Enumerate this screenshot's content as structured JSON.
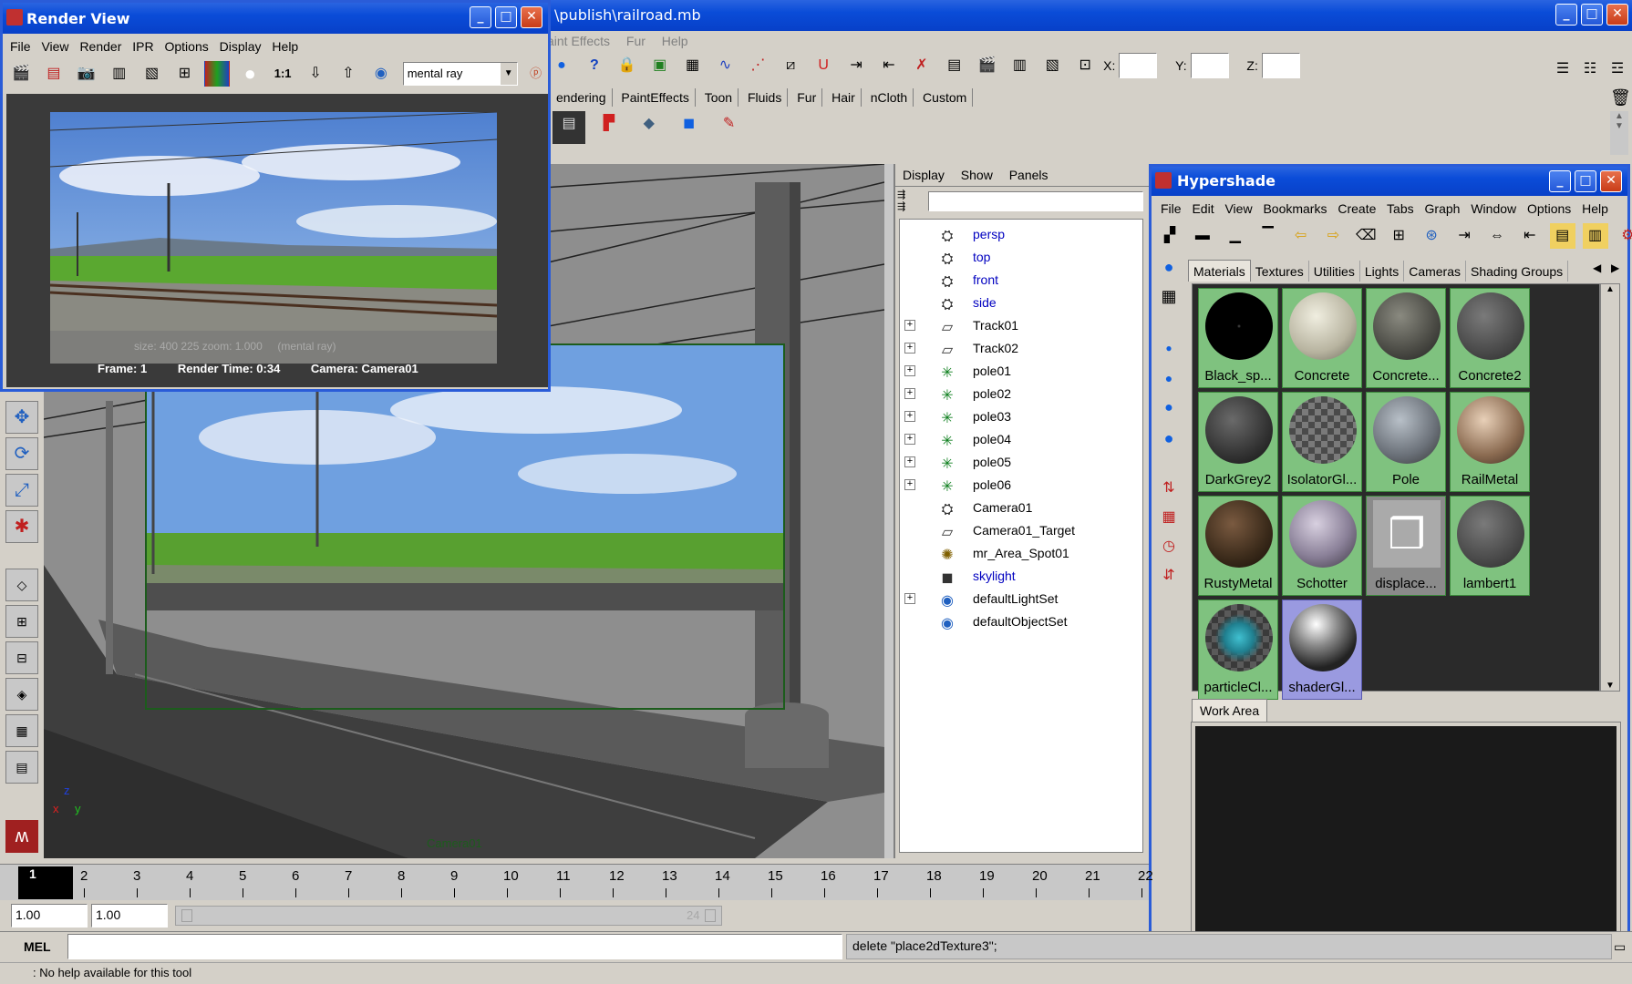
{
  "main": {
    "title": "\\publish\\railroad.mb",
    "menu": [
      "aint Effects",
      "Fur",
      "Help"
    ],
    "coords": {
      "x_label": "X:",
      "y_label": "Y:",
      "z_label": "Z:"
    },
    "shelf_tabs": [
      "endering",
      "PaintEffects",
      "Toon",
      "Fluids",
      "Fur",
      "Hair",
      "nCloth",
      "Custom"
    ]
  },
  "render_view": {
    "title": "Render View",
    "menu": [
      "File",
      "View",
      "Render",
      "IPR",
      "Options",
      "Display",
      "Help"
    ],
    "ratio_label": "1:1",
    "renderer": "mental ray",
    "overlay_text": "size: 400 225 zoom: 1.000     (mental ray)",
    "status": {
      "frame": "Frame: 1",
      "time": "Render Time: 0:34",
      "camera": "Camera: Camera01"
    }
  },
  "viewport": {
    "camera_label": "Camera01",
    "axis": {
      "x": "x",
      "y": "y",
      "z": "z"
    }
  },
  "outliner": {
    "menu": [
      "Display",
      "Show",
      "Panels"
    ],
    "items": [
      {
        "label": "persp",
        "icon": "camera-icon",
        "blue": true,
        "expandable": false
      },
      {
        "label": "top",
        "icon": "camera-icon",
        "blue": true,
        "expandable": false
      },
      {
        "label": "front",
        "icon": "camera-icon",
        "blue": true,
        "expandable": false
      },
      {
        "label": "side",
        "icon": "camera-icon",
        "blue": true,
        "expandable": false
      },
      {
        "label": "Track01",
        "icon": "curve-icon",
        "blue": false,
        "expandable": true
      },
      {
        "label": "Track02",
        "icon": "curve-icon",
        "blue": false,
        "expandable": true
      },
      {
        "label": "pole01",
        "icon": "joint-icon",
        "blue": false,
        "expandable": true
      },
      {
        "label": "pole02",
        "icon": "joint-icon",
        "blue": false,
        "expandable": true
      },
      {
        "label": "pole03",
        "icon": "joint-icon",
        "blue": false,
        "expandable": true
      },
      {
        "label": "pole04",
        "icon": "joint-icon",
        "blue": false,
        "expandable": true
      },
      {
        "label": "pole05",
        "icon": "joint-icon",
        "blue": false,
        "expandable": true
      },
      {
        "label": "pole06",
        "icon": "joint-icon",
        "blue": false,
        "expandable": true
      },
      {
        "label": "Camera01",
        "icon": "camera-icon",
        "blue": false,
        "expandable": false
      },
      {
        "label": "Camera01_Target",
        "icon": "curve-icon",
        "blue": false,
        "expandable": false
      },
      {
        "label": "mr_Area_Spot01",
        "icon": "light-icon",
        "blue": false,
        "expandable": false
      },
      {
        "label": "skylight",
        "icon": "skylight-icon",
        "blue": true,
        "expandable": false
      },
      {
        "label": "defaultLightSet",
        "icon": "set-icon",
        "blue": false,
        "expandable": true
      },
      {
        "label": "defaultObjectSet",
        "icon": "set-icon",
        "blue": false,
        "expandable": false
      }
    ]
  },
  "hypershade": {
    "title": "Hypershade",
    "menu": [
      "File",
      "Edit",
      "View",
      "Bookmarks",
      "Create",
      "Tabs",
      "Graph",
      "Window",
      "Options",
      "Help"
    ],
    "tabs": [
      "Materials",
      "Textures",
      "Utilities",
      "Lights",
      "Cameras",
      "Shading Groups"
    ],
    "work_area_tab": "Work Area",
    "materials": [
      {
        "name": "Black_sp...",
        "style": "black"
      },
      {
        "name": "Concrete",
        "style": "concrete"
      },
      {
        "name": "Concrete...",
        "style": "darkconcrete"
      },
      {
        "name": "Concrete2",
        "style": "grey"
      },
      {
        "name": "DarkGrey2",
        "style": "darkgrey"
      },
      {
        "name": "IsolatorGl...",
        "style": "checker"
      },
      {
        "name": "Pole",
        "style": "pole"
      },
      {
        "name": "RailMetal",
        "style": "railmetal"
      },
      {
        "name": "RustyMetal",
        "style": "rusty"
      },
      {
        "name": "Schotter",
        "style": "schotter"
      },
      {
        "name": "displace...",
        "style": "displace"
      },
      {
        "name": "lambert1",
        "style": "lambert"
      },
      {
        "name": "particleCl...",
        "style": "particle"
      },
      {
        "name": "shaderGl...",
        "style": "shaderglow"
      }
    ]
  },
  "timeline": {
    "frames": [
      "1",
      "2",
      "3",
      "4",
      "5",
      "6",
      "7",
      "8",
      "9",
      "10",
      "11",
      "12",
      "13",
      "14",
      "15",
      "16",
      "17",
      "18",
      "19",
      "20",
      "21",
      "22"
    ],
    "current_frame": "1",
    "range_start": "1.00",
    "range_start2": "1.00",
    "range_end_hint": "24"
  },
  "command_line": {
    "label": "MEL",
    "input": "",
    "result": "delete \"place2dTexture3\";"
  },
  "help_line": ": No help available for this tool"
}
